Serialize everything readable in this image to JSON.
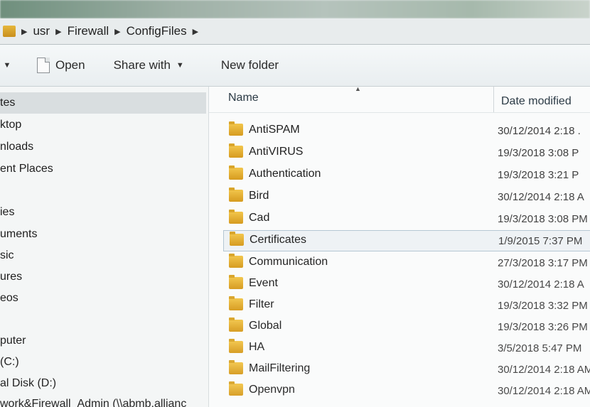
{
  "address_bar": {
    "crumbs": [
      "usr",
      "Firewall",
      "ConfigFiles"
    ]
  },
  "toolbar": {
    "open_label": "Open",
    "share_label": "Share with",
    "new_folder_label": "New folder"
  },
  "nav": {
    "items": [
      "tes",
      "ktop",
      "nloads",
      "ent Places",
      "ies",
      "uments",
      "sic",
      "ures",
      "eos",
      "puter",
      "(C:)",
      "al Disk (D:)",
      "work&Firewall_Admin (\\\\abmb.allianc"
    ]
  },
  "filelist": {
    "columns": {
      "name": "Name",
      "date": "Date modified"
    },
    "rows": [
      {
        "name": "AntiSPAM",
        "date": "30/12/2014 2:18 ."
      },
      {
        "name": "AntiVIRUS",
        "date": "19/3/2018 3:08 P"
      },
      {
        "name": "Authentication",
        "date": "19/3/2018 3:21 P"
      },
      {
        "name": "Bird",
        "date": "30/12/2014 2:18 A"
      },
      {
        "name": "Cad",
        "date": "19/3/2018 3:08 PM"
      },
      {
        "name": "Certificates",
        "date": "1/9/2015 7:37 PM"
      },
      {
        "name": "Communication",
        "date": "27/3/2018 3:17 PM"
      },
      {
        "name": "Event",
        "date": "30/12/2014 2:18 A"
      },
      {
        "name": "Filter",
        "date": "19/3/2018 3:32 PM"
      },
      {
        "name": "Global",
        "date": "19/3/2018 3:26 PM"
      },
      {
        "name": "HA",
        "date": "3/5/2018 5:47 PM"
      },
      {
        "name": "MailFiltering",
        "date": "30/12/2014 2:18 AM"
      },
      {
        "name": "Openvpn",
        "date": "30/12/2014 2:18 AM"
      }
    ]
  }
}
